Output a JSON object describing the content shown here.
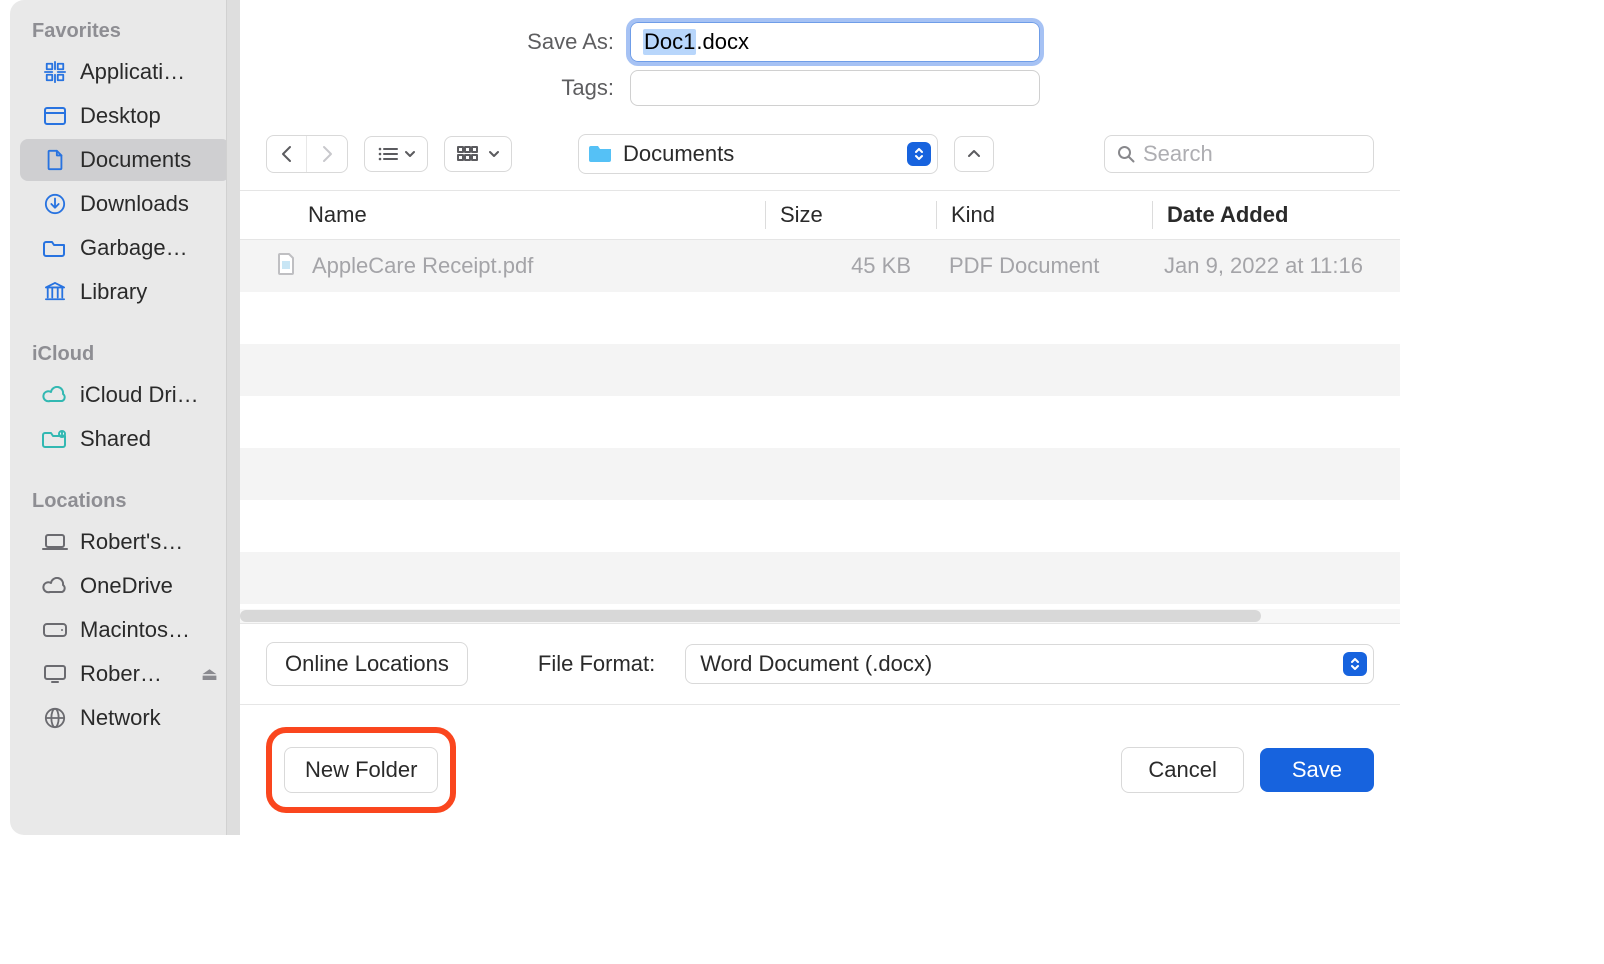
{
  "form": {
    "save_as_label": "Save As:",
    "filename_selected": "Doc1",
    "filename_rest": ".docx",
    "tags_label": "Tags:"
  },
  "sidebar": {
    "sections": [
      {
        "title": "Favorites",
        "items": [
          {
            "icon": "app-grid-icon",
            "label": "Applicati…"
          },
          {
            "icon": "desktop-icon",
            "label": "Desktop"
          },
          {
            "icon": "document-icon",
            "label": "Documents",
            "selected": true
          },
          {
            "icon": "download-icon",
            "label": "Downloads"
          },
          {
            "icon": "folder-icon",
            "label": "Garbage…"
          },
          {
            "icon": "library-icon",
            "label": "Library"
          }
        ]
      },
      {
        "title": "iCloud",
        "items": [
          {
            "icon": "cloud-icon",
            "label": "iCloud Dri…",
            "cloudcolor": true
          },
          {
            "icon": "shared-folder-icon",
            "label": "Shared",
            "cloudcolor": true
          }
        ]
      },
      {
        "title": "Locations",
        "items": [
          {
            "icon": "laptop-icon",
            "label": "Robert's…"
          },
          {
            "icon": "cloud-icon",
            "label": "OneDrive"
          },
          {
            "icon": "hdd-icon",
            "label": "Macintos…"
          },
          {
            "icon": "display-icon",
            "label": "Rober…",
            "eject": true
          },
          {
            "icon": "network-icon",
            "label": "Network"
          }
        ]
      }
    ]
  },
  "toolbar": {
    "location": "Documents",
    "search_placeholder": "Search"
  },
  "columns": {
    "name": "Name",
    "size": "Size",
    "kind": "Kind",
    "date": "Date Added"
  },
  "files": [
    {
      "name": "AppleCare Receipt.pdf",
      "size": "45 KB",
      "kind": "PDF Document",
      "date": "Jan 9, 2022 at 11:16"
    }
  ],
  "format": {
    "online_locations": "Online Locations",
    "label": "File Format:",
    "value": "Word Document (.docx)"
  },
  "actions": {
    "new_folder": "New Folder",
    "cancel": "Cancel",
    "save": "Save"
  }
}
